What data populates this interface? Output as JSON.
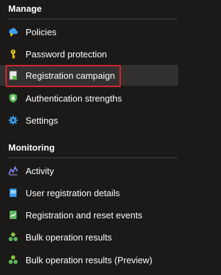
{
  "sections": [
    {
      "title": "Manage",
      "items": [
        {
          "label": "Policies",
          "icon": "policies-icon"
        },
        {
          "label": "Password protection",
          "icon": "key-icon"
        },
        {
          "label": "Registration campaign",
          "icon": "registration-campaign-icon",
          "selected": true
        },
        {
          "label": "Authentication strengths",
          "icon": "shield-icon"
        },
        {
          "label": "Settings",
          "icon": "gear-icon"
        }
      ]
    },
    {
      "title": "Monitoring",
      "items": [
        {
          "label": "Activity",
          "icon": "activity-chart-icon"
        },
        {
          "label": "User registration details",
          "icon": "user-details-icon"
        },
        {
          "label": "Registration and reset events",
          "icon": "events-log-icon"
        },
        {
          "label": "Bulk operation results",
          "icon": "group-icon"
        },
        {
          "label": "Bulk operation results (Preview)",
          "icon": "group-icon"
        }
      ]
    }
  ],
  "colors": {
    "background": "#1b1a19",
    "selected_background": "#323130",
    "highlight_border": "#d9262c"
  }
}
